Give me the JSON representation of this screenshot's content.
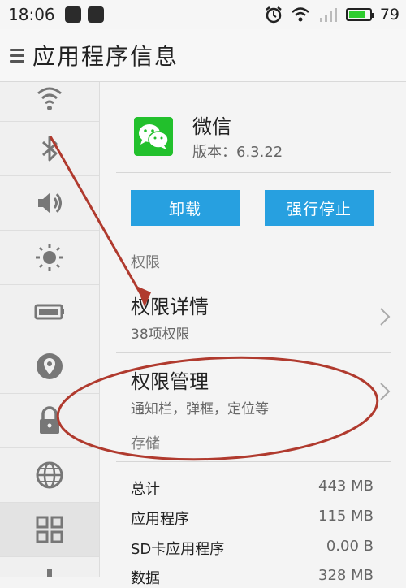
{
  "status_bar": {
    "time": "18:06",
    "battery": "79",
    "battery_level": 0.79
  },
  "title_bar": {
    "title": "应用程序信息"
  },
  "sidebar": {
    "items": [
      {
        "icon": "wifi-icon"
      },
      {
        "icon": "bluetooth-icon"
      },
      {
        "icon": "volume-icon"
      },
      {
        "icon": "brightness-icon"
      },
      {
        "icon": "battery-icon"
      },
      {
        "icon": "location-icon"
      },
      {
        "icon": "lock-icon"
      },
      {
        "icon": "globe-icon"
      },
      {
        "icon": "apps-grid-icon",
        "active": true
      }
    ]
  },
  "app": {
    "name": "微信",
    "version": "版本：6.3.22"
  },
  "buttons": {
    "uninstall": "卸载",
    "force_stop": "强行停止"
  },
  "permissions": {
    "section_label": "权限",
    "details_title": "权限详情",
    "details_sub": "38项权限",
    "manage_title": "权限管理",
    "manage_sub": "通知栏，弹框，定位等"
  },
  "storage": {
    "section_label": "存储",
    "rows": [
      {
        "label": "总计",
        "value": "443 MB"
      },
      {
        "label": "应用程序",
        "value": "115 MB"
      },
      {
        "label": "SD卡应用程序",
        "value": "0.00 B"
      },
      {
        "label": "数据",
        "value": "328 MB"
      }
    ]
  },
  "colors": {
    "accent": "#27a0e0",
    "wechat_green": "#22c02c",
    "annotation": "#b03a2e",
    "battery_green": "#2ecc2e"
  }
}
